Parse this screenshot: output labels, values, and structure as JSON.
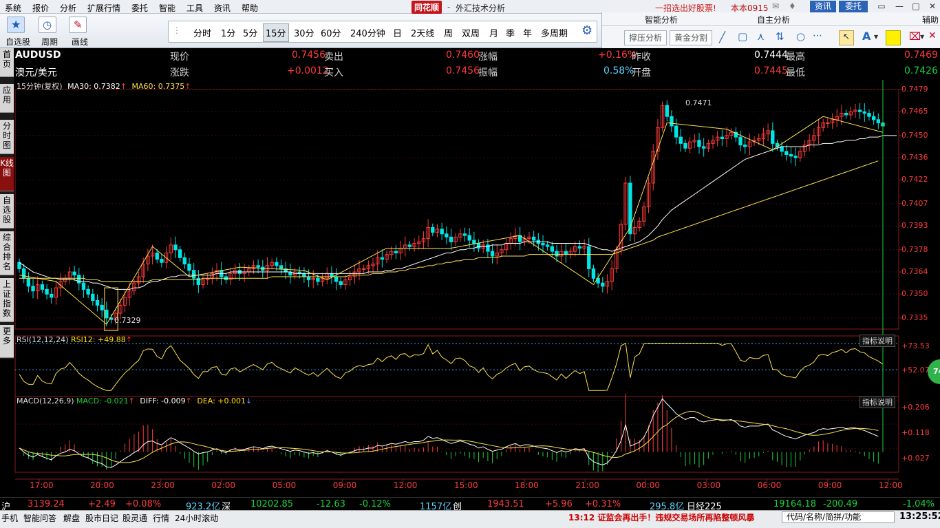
{
  "menu": {
    "items": [
      "系统",
      "报价",
      "分析",
      "扩展行情",
      "委托",
      "智能",
      "工具",
      "资讯",
      "帮助"
    ],
    "brand": "同花顺",
    "app_title": "外汇技术分析",
    "promo": "一招选出好股票!",
    "user": "本本0915",
    "btn_zixun": "资讯",
    "btn_weituo": "委托"
  },
  "toolbar": {
    "zixuan": "自选股",
    "zhouqi": "周期",
    "huaxian": "画线",
    "periods": [
      "分时",
      "1分",
      "5分",
      "15分",
      "30分",
      "60分",
      "240分钟",
      "日",
      "2天线",
      "周",
      "双周",
      "月",
      "季",
      "年",
      "多周期"
    ],
    "selected_period": "15分"
  },
  "smart": {
    "zhineng_title": "智能分析",
    "zizhu_title": "自主分析",
    "fuzhu_title": "辅助",
    "btn_yazhi": "撑压分析",
    "btn_huangjin": "黄金分割"
  },
  "left_tabs": [
    {
      "label": "首页"
    },
    {
      "label": "应用"
    },
    {
      "label": "分时图"
    },
    {
      "label": "K线图"
    },
    {
      "label": "自选股"
    },
    {
      "label": "综合排名"
    },
    {
      "label": "上证指数"
    },
    {
      "label": "更多"
    }
  ],
  "quote": {
    "code": "AUDUSD",
    "name": "澳元/美元",
    "l_xianjia": "现价",
    "v_xianjia": "0.7456",
    "l_zhangdie": "涨跌",
    "v_zhangdie": "+0.0012",
    "l_maichu": "卖出",
    "v_maichu": "0.7460",
    "l_mairu": "买入",
    "v_mairu": "0.7456",
    "l_zhangfu": "涨幅",
    "v_zhangfu": "+0.16%",
    "l_zhenfu": "振幅",
    "v_zhenfu": "0.58%",
    "l_zuoshou": "昨收",
    "v_zuoshou": "0.7444",
    "l_kaipan": "开盘",
    "v_kaipan": "0.7445",
    "l_zuigao": "最高",
    "v_zuigao": "0.7469",
    "l_zuidi": "最低",
    "v_zuidi": "0.7426"
  },
  "main_chart": {
    "period_label": "15分钟(复权)",
    "ma30_label": "MA30: 0.7382",
    "ma60_label": "MA60: 0.7375",
    "high_annot": "0.7471",
    "low_annot": "0.7329",
    "price_axis": [
      "0.7479",
      "0.7465",
      "0.7450",
      "0.7436",
      "0.7422",
      "0.7407",
      "0.7393",
      "0.7378",
      "0.7364",
      "0.7350",
      "0.7335"
    ],
    "time_axis": [
      "17:00",
      "20:00",
      "23:00",
      "02:00",
      "05:00",
      "09:00",
      "12:00",
      "15:00",
      "18:00",
      "21:00",
      "00:00",
      "03:00",
      "06:00",
      "09:00",
      "12:00"
    ]
  },
  "rsi": {
    "label": "RSI(12,12,24)",
    "value_label": "RSI12: +49.88",
    "axis": [
      "+73.53",
      "+52.07"
    ],
    "help": "指标说明",
    "badge": "74"
  },
  "macd": {
    "label": "MACD(12,26,9)",
    "macd_label": "MACD: -0.021",
    "diff_label": "DIFF: -0.009",
    "dea_label": "DEA: +0.001",
    "axis": [
      "+0.206",
      "+0.118",
      "+0.027"
    ],
    "help": "指标说明"
  },
  "chart_data": {
    "type": "candlestick",
    "series_name": "AUDUSD 15分",
    "ylim": [
      0.7328,
      0.7479
    ],
    "x_ticks": [
      "17:00",
      "20:00",
      "23:00",
      "02:00",
      "05:00",
      "09:00",
      "12:00",
      "15:00",
      "18:00",
      "21:00",
      "00:00",
      "03:00",
      "06:00",
      "09:00",
      "12:00"
    ],
    "close": [
      0.7366,
      0.736,
      0.7355,
      0.7352,
      0.7356,
      0.7353,
      0.735,
      0.7348,
      0.7354,
      0.7358,
      0.736,
      0.7364,
      0.7362,
      0.7357,
      0.7353,
      0.735,
      0.7346,
      0.7343,
      0.734,
      0.7335,
      0.7334,
      0.7338,
      0.7343,
      0.7348,
      0.7352,
      0.7357,
      0.7361,
      0.7369,
      0.7374,
      0.7376,
      0.7372,
      0.737,
      0.7376,
      0.7381,
      0.7378,
      0.7373,
      0.7369,
      0.7365,
      0.736,
      0.7356,
      0.7359,
      0.736,
      0.7363,
      0.7365,
      0.7361,
      0.7359,
      0.7363,
      0.7365,
      0.7363,
      0.7364,
      0.7366,
      0.7368,
      0.7367,
      0.7365,
      0.7368,
      0.737,
      0.7368,
      0.7366,
      0.7364,
      0.7362,
      0.7364,
      0.7363,
      0.7361,
      0.7359,
      0.736,
      0.7358,
      0.736,
      0.7363,
      0.7361,
      0.7358,
      0.7356,
      0.7359,
      0.7361,
      0.7364,
      0.7366,
      0.7366,
      0.7368,
      0.7369,
      0.7373,
      0.7372,
      0.7375,
      0.7377,
      0.7376,
      0.7379,
      0.7381,
      0.738,
      0.7382,
      0.7383,
      0.7385,
      0.7392,
      0.7389,
      0.7391,
      0.7388,
      0.7386,
      0.7383,
      0.7386,
      0.7388,
      0.7387,
      0.7384,
      0.7382,
      0.7379,
      0.7381,
      0.7377,
      0.7374,
      0.7376,
      0.7378,
      0.7382,
      0.7385,
      0.7387,
      0.7383,
      0.7385,
      0.7386,
      0.7384,
      0.7382,
      0.7381,
      0.738,
      0.7377,
      0.7374,
      0.7377,
      0.7375,
      0.7377,
      0.738,
      0.7379,
      0.738,
      0.7366,
      0.736,
      0.7357,
      0.7355,
      0.7358,
      0.7366,
      0.7378,
      0.7394,
      0.742,
      0.7388,
      0.7392,
      0.7396,
      0.7405,
      0.742,
      0.744,
      0.7455,
      0.7469,
      0.7462,
      0.7456,
      0.7449,
      0.7445,
      0.7442,
      0.7446,
      0.7447,
      0.7443,
      0.7442,
      0.7445,
      0.7447,
      0.7449,
      0.7448,
      0.745,
      0.7452,
      0.7449,
      0.7444,
      0.7443,
      0.7446,
      0.7447,
      0.7448,
      0.7451,
      0.7453,
      0.7445,
      0.7443,
      0.744,
      0.7438,
      0.7437,
      0.7436,
      0.744,
      0.7444,
      0.7447,
      0.745,
      0.7455,
      0.7458,
      0.7458,
      0.746,
      0.7462,
      0.7464,
      0.7463,
      0.7465,
      0.7466,
      0.7465,
      0.7464,
      0.7462,
      0.746,
      0.7458,
      0.7456
    ],
    "ma30": [
      0.737,
      0.7368,
      0.7366,
      0.7364,
      0.7363,
      0.7362,
      0.7361,
      0.736,
      0.736,
      0.7359,
      0.7359,
      0.7359,
      0.7359,
      0.7358,
      0.7358,
      0.7358,
      0.7357,
      0.7357,
      0.7356,
      0.7355,
      0.7354,
      0.7353,
      0.7353,
      0.7353,
      0.7353,
      0.7354,
      0.7354,
      0.7355,
      0.7357,
      0.7358,
      0.7358,
      0.7359,
      0.736,
      0.7361,
      0.7361,
      0.7362,
      0.7362,
      0.7362,
      0.7362,
      0.7362,
      0.7362,
      0.7362,
      0.7362,
      0.7363,
      0.7363,
      0.7363,
      0.7364,
      0.7364,
      0.7364,
      0.7364,
      0.7364,
      0.7364,
      0.7364,
      0.7364,
      0.7364,
      0.7364,
      0.7364,
      0.7364,
      0.7364,
      0.7364,
      0.7363,
      0.7363,
      0.7363,
      0.7363,
      0.7363,
      0.7363,
      0.7363,
      0.7363,
      0.7363,
      0.7363,
      0.7363,
      0.7363,
      0.7363,
      0.7363,
      0.7363,
      0.7363,
      0.7364,
      0.7364,
      0.7364,
      0.7364,
      0.7365,
      0.7365,
      0.7366,
      0.7366,
      0.7367,
      0.7368,
      0.7369,
      0.737,
      0.7371,
      0.7372,
      0.7373,
      0.7374,
      0.7375,
      0.7376,
      0.7376,
      0.7377,
      0.7378,
      0.7378,
      0.7379,
      0.7379,
      0.738,
      0.738,
      0.738,
      0.7381,
      0.7381,
      0.7381,
      0.7382,
      0.7382,
      0.7382,
      0.7382,
      0.7383,
      0.7383,
      0.7383,
      0.7383,
      0.7383,
      0.7383,
      0.7382,
      0.7382,
      0.7382,
      0.7382,
      0.7382,
      0.7382,
      0.7382,
      0.7382,
      0.7381,
      0.738,
      0.7379,
      0.7378,
      0.7378,
      0.7377,
      0.7378,
      0.7379,
      0.738,
      0.7381,
      0.7382,
      0.7383,
      0.7385,
      0.7387,
      0.739,
      0.7393,
      0.7397,
      0.74,
      0.7403,
      0.7405,
      0.7407,
      0.7409,
      0.7411,
      0.7413,
      0.7415,
      0.7417,
      0.7419,
      0.7421,
      0.7423,
      0.7425,
      0.7427,
      0.7429,
      0.7431,
      0.7433,
      0.7435,
      0.7436,
      0.7437,
      0.7438,
      0.7439,
      0.744,
      0.7441,
      0.7442,
      0.7443,
      0.7443,
      0.7443,
      0.7443,
      0.7443,
      0.7443,
      0.7444,
      0.7444,
      0.7444,
      0.7445,
      0.7445,
      0.7445,
      0.7446,
      0.7446,
      0.7447,
      0.7447,
      0.7447,
      0.7448,
      0.7448,
      0.7449,
      0.7449,
      0.7449,
      0.745,
      0.745,
      0.745,
      0.745
    ],
    "ma60": [
      0.736,
      0.736,
      0.736,
      0.736,
      0.736,
      0.736,
      0.736,
      0.736,
      0.736,
      0.736,
      0.736,
      0.736,
      0.736,
      0.736,
      0.736,
      0.7359,
      0.7359,
      0.7359,
      0.7358,
      0.7358,
      0.7358,
      0.7358,
      0.7358,
      0.7358,
      0.7358,
      0.7358,
      0.7358,
      0.7358,
      0.7358,
      0.7359,
      0.7359,
      0.7359,
      0.7359,
      0.7359,
      0.7359,
      0.7359,
      0.7359,
      0.7359,
      0.7359,
      0.7359,
      0.736,
      0.736,
      0.736,
      0.736,
      0.736,
      0.736,
      0.736,
      0.736,
      0.736,
      0.736,
      0.736,
      0.736,
      0.736,
      0.736,
      0.736,
      0.7361,
      0.7361,
      0.7361,
      0.7361,
      0.7361,
      0.7361,
      0.7361,
      0.7361,
      0.7361,
      0.7361,
      0.7361,
      0.7361,
      0.7361,
      0.7361,
      0.7361,
      0.7361,
      0.7361,
      0.7362,
      0.7362,
      0.7362,
      0.7362,
      0.7362,
      0.7363,
      0.7363,
      0.7363,
      0.7364,
      0.7364,
      0.7364,
      0.7365,
      0.7365,
      0.7366,
      0.7366,
      0.7367,
      0.7367,
      0.7368,
      0.7368,
      0.7369,
      0.7369,
      0.737,
      0.737,
      0.7371,
      0.7371,
      0.7372,
      0.7372,
      0.7372,
      0.7373,
      0.7373,
      0.7373,
      0.7373,
      0.7373,
      0.7374,
      0.7374,
      0.7374,
      0.7374,
      0.7374,
      0.7374,
      0.7375,
      0.7375,
      0.7375,
      0.7375,
      0.7375,
      0.7375,
      0.7375,
      0.7375,
      0.7375,
      0.7375,
      0.7375,
      0.7375,
      0.7375,
      0.7375,
      0.7375,
      0.7375,
      0.7375,
      0.7375,
      0.7375,
      0.7376,
      0.7377,
      0.7378,
      0.7379,
      0.738,
      0.7381,
      0.7382,
      0.7383,
      0.7384,
      0.7386,
      0.7387,
      0.7388,
      0.7389,
      0.739,
      0.7391,
      0.7392,
      0.7393,
      0.7394,
      0.7395,
      0.7396,
      0.7397,
      0.7398,
      0.7399,
      0.74,
      0.7401,
      0.7402,
      0.7403,
      0.7404,
      0.7405,
      0.7406,
      0.7407,
      0.7408,
      0.7409,
      0.741,
      0.7411,
      0.7412,
      0.7413,
      0.7414,
      0.7415,
      0.7416,
      0.7417,
      0.7418,
      0.7419,
      0.742,
      0.7421,
      0.7422,
      0.7423,
      0.7424,
      0.7425,
      0.7426,
      0.7427,
      0.7428,
      0.7429,
      0.743,
      0.7431,
      0.7432,
      0.7433,
      0.7434
    ],
    "rsi_ylim": [
      30,
      80
    ],
    "macd_ylim": [
      -0.06,
      0.22
    ]
  },
  "index_bar": {
    "sh_label": "沪",
    "sh_val": "3139.24",
    "sh_chg": "+2.49",
    "sh_pct": "+0.08%",
    "sh_amt": "923.2亿",
    "sz_label": "深",
    "sz_val": "10202.85",
    "sz_chg": "-12.63",
    "sz_pct": "-0.12%",
    "sz_amt": "1157亿",
    "cy_label": "创",
    "cy_val": "1943.51",
    "cy_chg": "+5.96",
    "cy_pct": "+0.31%",
    "cy_amt": "295.8亿",
    "nk_label": "日经225",
    "nk_val": "19164.18",
    "nk_chg": "-200.49",
    "nk_pct": "-1.04%"
  },
  "bottom": {
    "items": [
      "手机",
      "智能问答",
      "解盘",
      "股市日记",
      "股灵通",
      "行情",
      "24小时滚动"
    ],
    "news": "13:12 证监会再出手！违规交易场所再陷整顿风暴",
    "search_placeholder": "代码/名称/简拼/功能",
    "clock": "13:25:52"
  },
  "colors": {
    "up": "#ff3b3b",
    "down": "#00e6e6",
    "ma30": "#ffffff",
    "ma60": "#ffe34d",
    "bg": "#000000"
  }
}
